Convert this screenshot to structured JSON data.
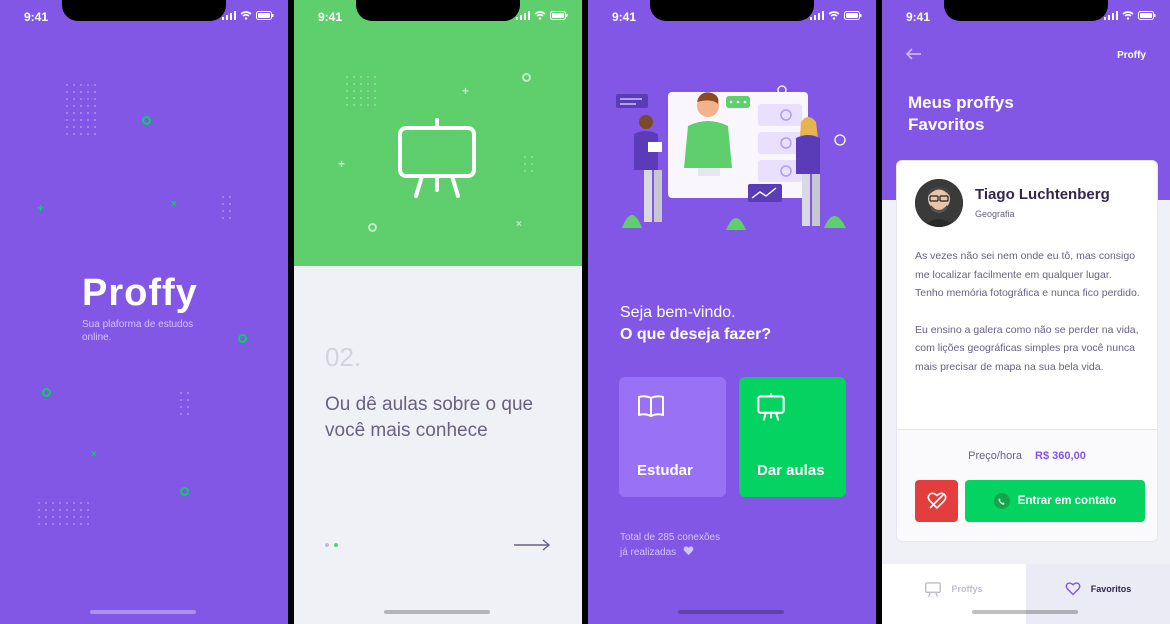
{
  "colors": {
    "primary": "#8257E5",
    "secondary": "#04D361",
    "green_bg": "#5FCF6E",
    "danger": "#E33D3D",
    "light_bg": "#F0F0F7"
  },
  "status_time": "9:41",
  "screen1": {
    "logo": "Proffy",
    "tagline": "Sua plaforma de estudos online."
  },
  "screen2": {
    "step": "02.",
    "text": "Ou dê aulas sobre o que você mais conhece",
    "icon": "easel-icon"
  },
  "screen3": {
    "welcome": "Seja bem-vindo.",
    "question": "O que deseja fazer?",
    "study_label": "Estudar",
    "teach_label": "Dar aulas",
    "total_line1": "Total de 285 conexões",
    "total_line2": "já realizadas"
  },
  "screen4": {
    "brand": "Proffy",
    "title": "Meus proffys Favoritos",
    "teacher": {
      "name": "Tiago Luchtenberg",
      "subject": "Geografia",
      "bio1": "As vezes não sei nem onde eu tô, mas consigo me localizar facilmente em qualquer lugar. Tenho memória fotográfica e nunca fico perdido.",
      "bio2": "Eu ensino a galera como não se perder na vida, com lições geográficas simples pra você nunca mais precisar de mapa na sua bela vida."
    },
    "price_label": "Preço/hora",
    "price_value": "R$ 360,00",
    "contact_label": "Entrar em contato",
    "tabs": [
      {
        "label": "Proffys"
      },
      {
        "label": "Favoritos"
      }
    ]
  }
}
